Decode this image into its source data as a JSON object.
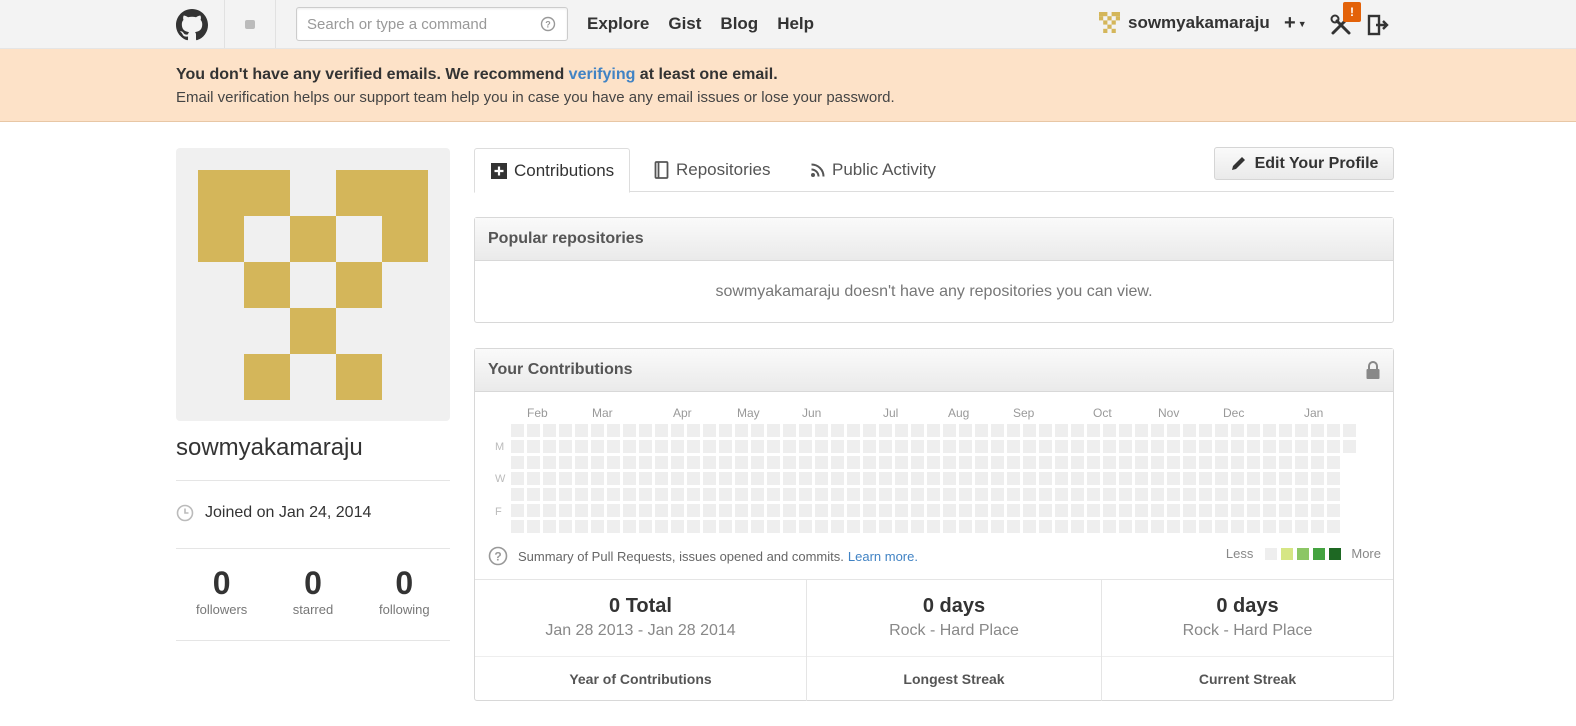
{
  "header": {
    "search_placeholder": "Search or type a command",
    "nav": [
      "Explore",
      "Gist",
      "Blog",
      "Help"
    ],
    "username": "sowmyakamaraju",
    "create_label": "+",
    "notification_badge": "!"
  },
  "flash": {
    "line1_prefix": "You don't have any verified emails. We recommend ",
    "line1_link": "verifying",
    "line1_suffix": " at least one email.",
    "line2": "Email verification helps our support team help you in case you have any email issues or lose your password."
  },
  "profile": {
    "name": "sowmyakamaraju",
    "joined": "Joined on Jan 24, 2014",
    "avatar_color": "#d4b65a",
    "stats": [
      {
        "value": "0",
        "label": "followers"
      },
      {
        "value": "0",
        "label": "starred"
      },
      {
        "value": "0",
        "label": "following"
      }
    ]
  },
  "tabs": {
    "contributions": "Contributions",
    "repositories": "Repositories",
    "activity": "Public Activity",
    "edit_profile": "Edit Your Profile"
  },
  "popular": {
    "title": "Popular repositories",
    "empty": "sowmyakamaraju doesn't have any repositories you can view."
  },
  "contributions": {
    "title": "Your Contributions",
    "months": [
      "Feb",
      "Mar",
      "Apr",
      "May",
      "Jun",
      "Jul",
      "Aug",
      "Sep",
      "Oct",
      "Nov",
      "Dec",
      "Jan"
    ],
    "days": [
      "M",
      "W",
      "F"
    ],
    "summary": "Summary of Pull Requests, issues opened and commits.",
    "learn_more": "Learn more.",
    "legend_less": "Less",
    "legend_more": "More",
    "legend_colors": [
      "#eeeeee",
      "#d6e685",
      "#8cc665",
      "#44a340",
      "#1e6823"
    ],
    "empty_cell_color": "#eeeeee",
    "weeks": 53
  },
  "streaks": [
    {
      "big": "0 Total",
      "range": "Jan 28 2013 - Jan 28 2014",
      "label": "Year of Contributions"
    },
    {
      "big": "0 days",
      "range": "Rock - Hard Place",
      "label": "Longest Streak"
    },
    {
      "big": "0 days",
      "range": "Rock - Hard Place",
      "label": "Current Streak"
    }
  ]
}
